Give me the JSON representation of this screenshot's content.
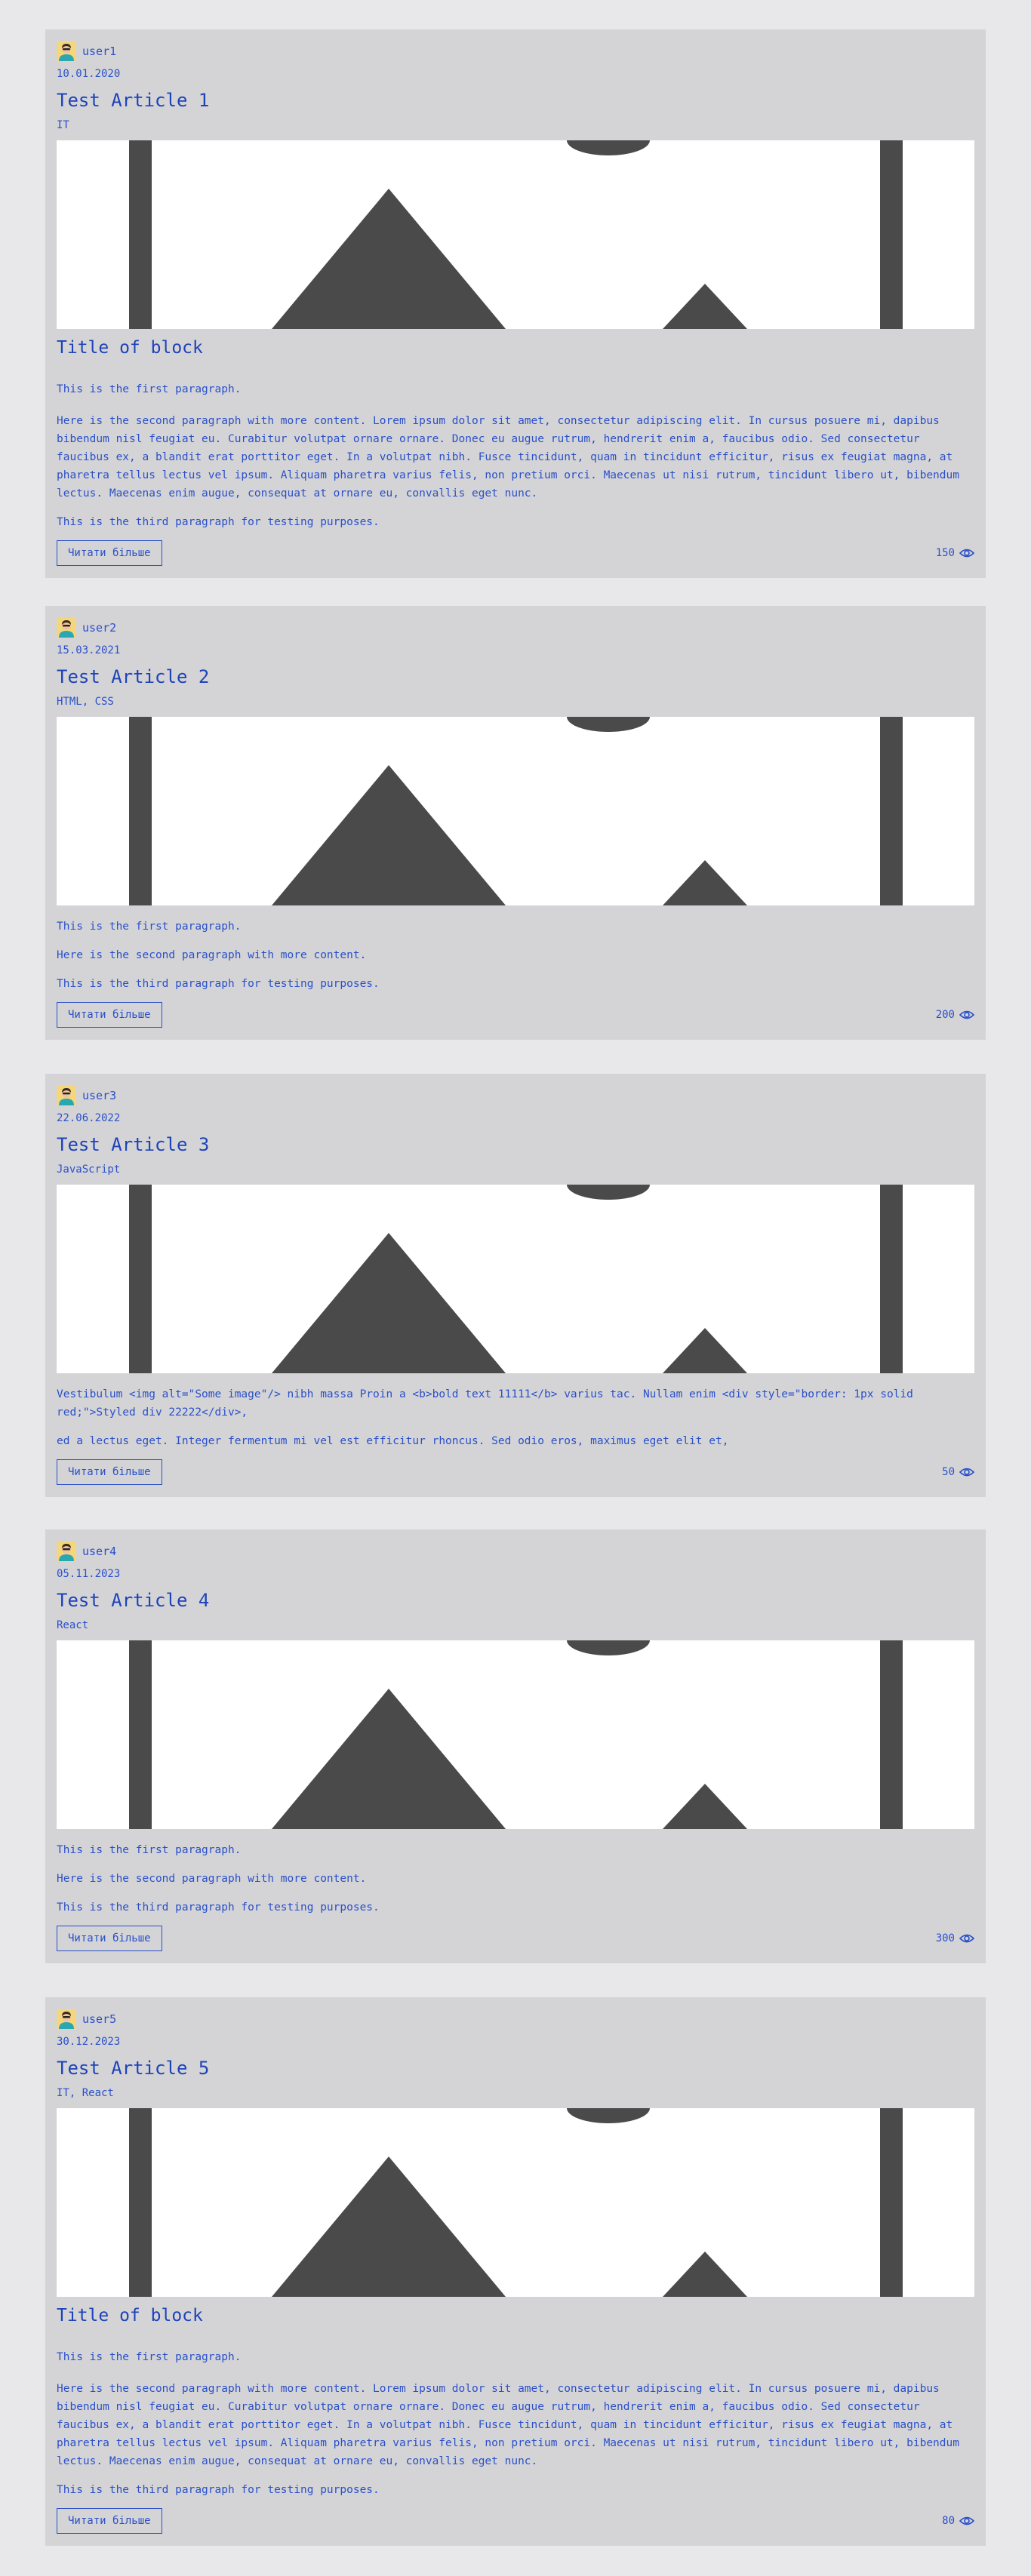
{
  "ui": {
    "read_more_label": "Читати більше",
    "block_title": "Title of block",
    "p_first": "This is the first paragraph.",
    "p_second_short": "Here is the second paragraph with more content.",
    "p_second_long": "Here is the second paragraph with more content. Lorem ipsum dolor sit amet, consectetur adipiscing elit. In cursus posuere mi, dapibus bibendum nisl feugiat eu. Curabitur volutpat ornare ornare. Donec eu augue rutrum, hendrerit enim a, faucibus odio. Sed consectetur faucibus ex, a blandit erat porttitor eget. In a volutpat nibh. Fusce tincidunt, quam in tincidunt efficitur, risus ex feugiat magna, at pharetra tellus lectus vel ipsum. Aliquam pharetra varius felis, non pretium orci. Maecenas ut nisi rutrum, tincidunt libero ut, bibendum lectus. Maecenas enim augue, consequat at ornare eu, convallis eget nunc.",
    "p_third": "This is the third paragraph for testing purposes.",
    "p_html_1": "Vestibulum <img alt=\"Some image\"/> nibh massa Proin a <b>bold text 11111</b> varius tac. Nullam enim <div style=\"border: 1px solid red;\">Styled div 22222</div>,",
    "p_html_2": "ed a lectus eget. Integer fermentum mi vel est efficitur rhoncus. Sed odio eros, maximus eget elit et,"
  },
  "articles": [
    {
      "author": "user1",
      "date": "10.01.2020",
      "title": "Test Article 1",
      "tags": "IT",
      "views": "150"
    },
    {
      "author": "user2",
      "date": "15.03.2021",
      "title": "Test Article 2",
      "tags": "HTML, CSS",
      "views": "200"
    },
    {
      "author": "user3",
      "date": "22.06.2022",
      "title": "Test Article 3",
      "tags": "JavaScript",
      "views": "50"
    },
    {
      "author": "user4",
      "date": "05.11.2023",
      "title": "Test Article 4",
      "tags": "React",
      "views": "300"
    },
    {
      "author": "user5",
      "date": "30.12.2023",
      "title": "Test Article 5",
      "tags": "IT, React",
      "views": "80"
    }
  ],
  "icons": {
    "avatar": "avatar-icon",
    "views": "eye-icon",
    "cover": "image-placeholder"
  },
  "colors": {
    "background": "#e8e8ea",
    "card": "#d4d4d7",
    "text": "#2a50c8",
    "cover_shapes": "#4a4a4a"
  }
}
